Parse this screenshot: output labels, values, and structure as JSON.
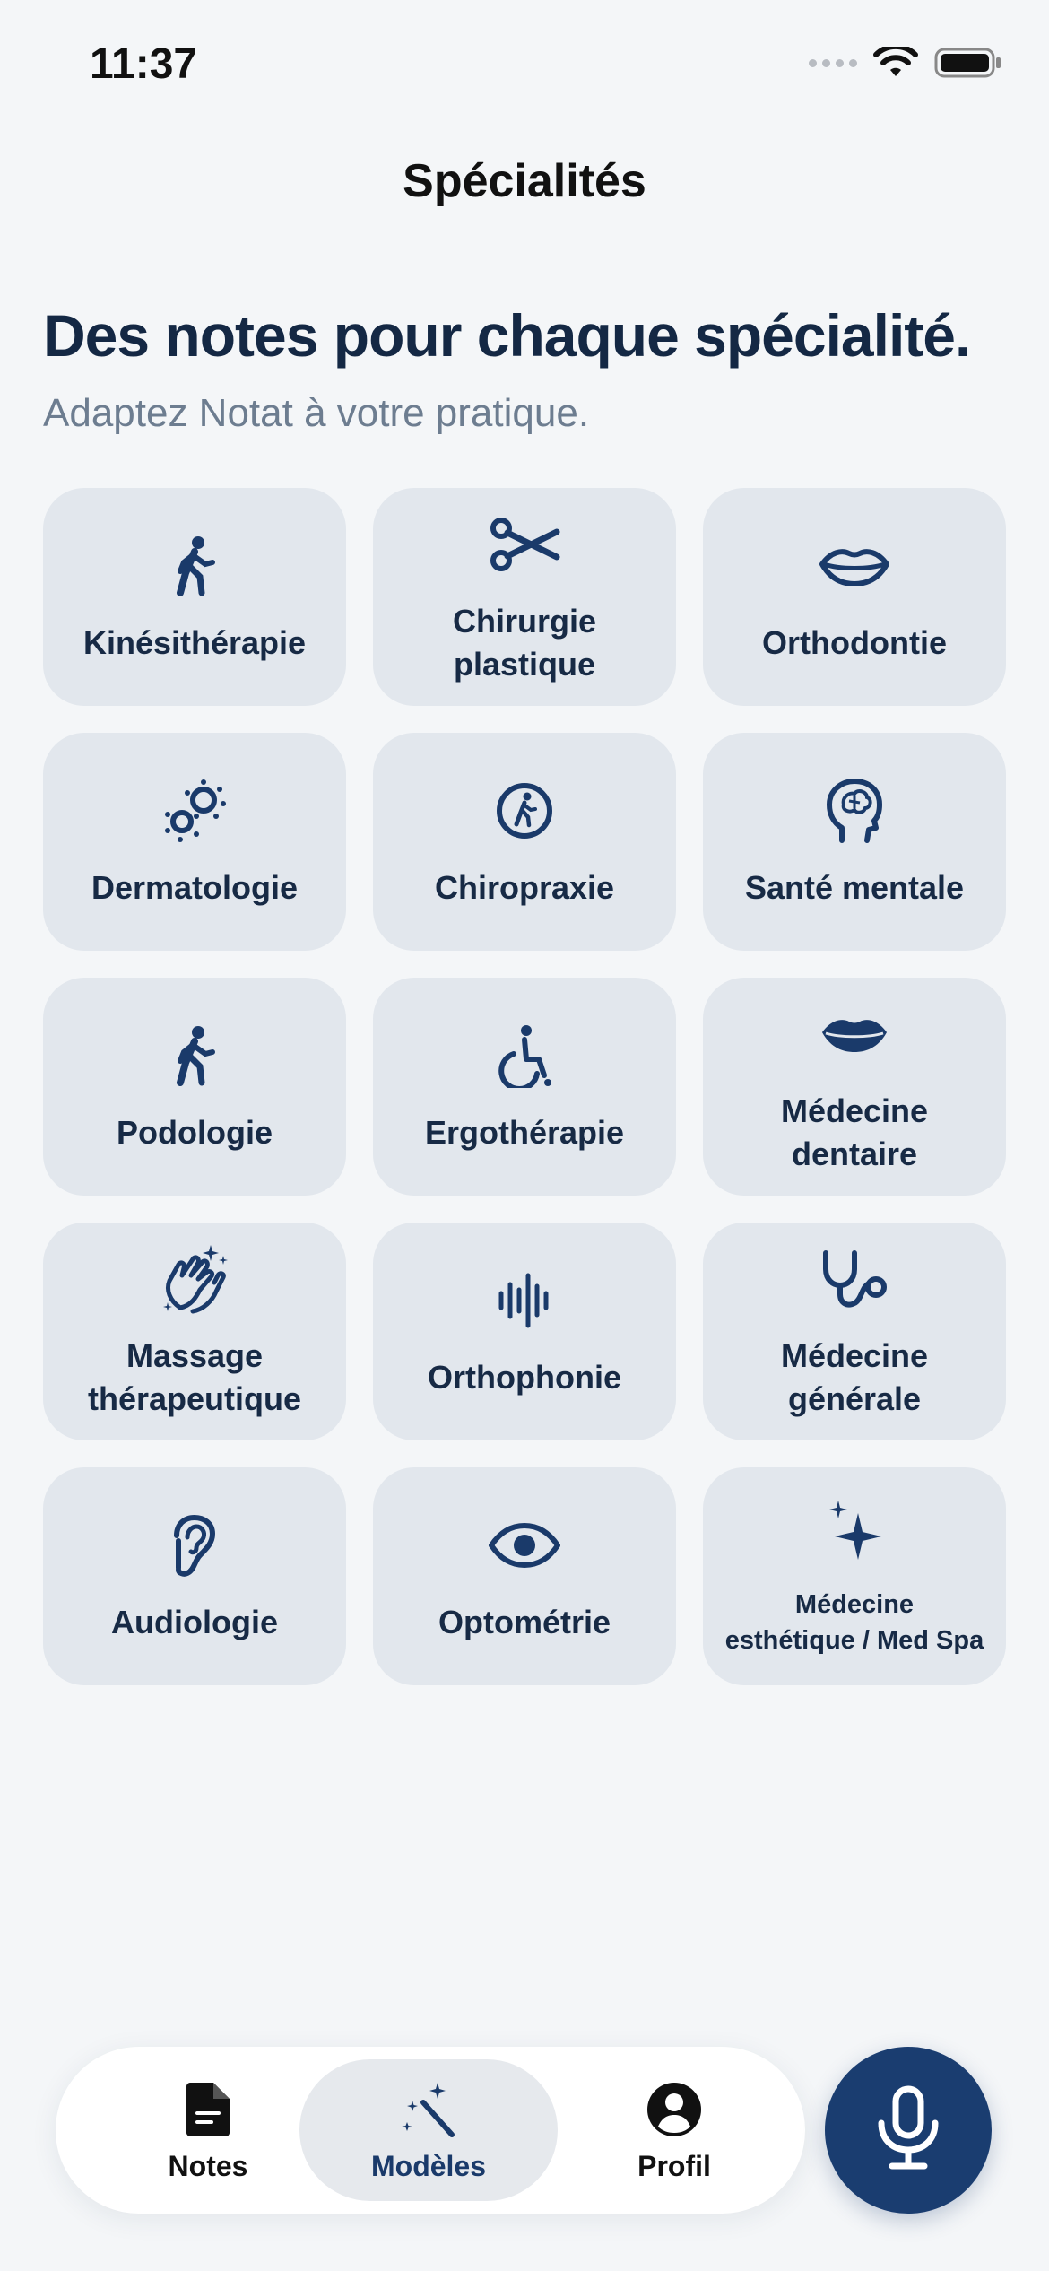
{
  "status_bar": {
    "time": "11:37"
  },
  "header": {
    "title": "Spécialités",
    "headline": "Des notes pour chaque spécialité.",
    "subline": "Adaptez Notat à votre pratique."
  },
  "specialties": [
    {
      "label": "Kinésithérapie",
      "icon": "walking-person-icon"
    },
    {
      "label": "Chirurgie\nplastique",
      "icon": "scissors-icon"
    },
    {
      "label": "Orthodontie",
      "icon": "lips-outline-icon"
    },
    {
      "label": "Dermatologie",
      "icon": "allergens-icon"
    },
    {
      "label": "Chiropraxie",
      "icon": "figure-walk-circle-icon"
    },
    {
      "label": "Santé mentale",
      "icon": "brain-head-icon"
    },
    {
      "label": "Podologie",
      "icon": "walking-person-icon"
    },
    {
      "label": "Ergothérapie",
      "icon": "wheelchair-icon"
    },
    {
      "label": "Médecine\ndentaire",
      "icon": "lips-filled-icon"
    },
    {
      "label": "Massage\nthérapeutique",
      "icon": "hands-clap-sparkle-icon"
    },
    {
      "label": "Orthophonie",
      "icon": "waveform-icon"
    },
    {
      "label": "Médecine\ngénérale",
      "icon": "stethoscope-icon"
    },
    {
      "label": "Audiologie",
      "icon": "ear-icon"
    },
    {
      "label": "Optométrie",
      "icon": "eye-icon"
    },
    {
      "label": "Médecine\nesthétique / Med Spa",
      "icon": "sparkles-icon"
    }
  ],
  "tab_bar": {
    "tabs": [
      {
        "label": "Notes",
        "icon": "document-icon",
        "active": false
      },
      {
        "label": "Modèles",
        "icon": "magic-wand-icon",
        "active": true
      },
      {
        "label": "Profil",
        "icon": "person-circle-icon",
        "active": false
      }
    ],
    "record_icon": "microphone-icon"
  },
  "colors": {
    "background": "#f4f6f8",
    "card": "#e2e7ed",
    "icon": "#1a3a6a",
    "heading": "#142844",
    "subtext": "#6d7d90",
    "accent": "#1a3d70"
  }
}
